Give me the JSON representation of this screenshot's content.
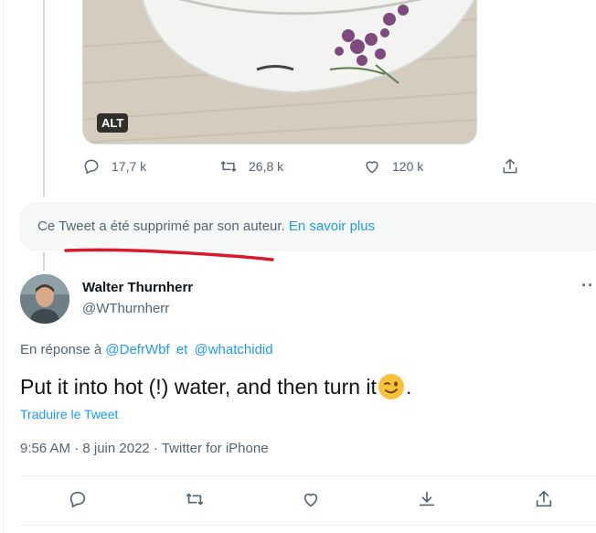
{
  "media": {
    "alt_badge": "ALT"
  },
  "parent_actions": {
    "replies": "17,7 k",
    "retweets": "26,8 k",
    "likes": "120 k"
  },
  "deleted_notice": {
    "text": "Ce Tweet a été supprimé par son auteur.",
    "link": "En savoir plus"
  },
  "tweet": {
    "author_name": "Walter Thurnherr",
    "author_handle": "@WThurnherr",
    "more": "··",
    "reply_prefix": "En réponse à",
    "mention_1": "@DefrWbf",
    "reply_joiner": "et",
    "mention_2": "@whatchidid",
    "text": "Put it into hot (!) water, and then turn it",
    "text_end": ".",
    "translate": "Traduire le Tweet",
    "meta": "9:56 AM · 8 juin 2022 · Twitter for iPhone"
  },
  "colors": {
    "link": "#1d9bf0",
    "secondary_text": "#536471",
    "annotation_red": "#d81b2b"
  }
}
